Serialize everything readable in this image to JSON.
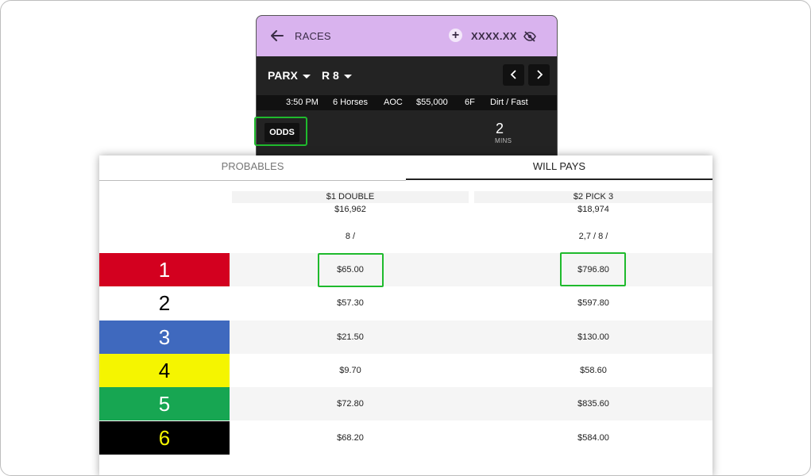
{
  "header": {
    "back_label": "RACES",
    "balance": "XXXX.XX"
  },
  "race_select": {
    "track": "PARX",
    "race": "R 8"
  },
  "race_info": {
    "post_time": "3:50 PM",
    "field_size": "6 Horses",
    "race_type": "AOC",
    "purse": "$55,000",
    "distance": "6F",
    "surface": "Dirt / Fast"
  },
  "odds_button": "ODDS",
  "mtp": {
    "value": "2",
    "label": "MINS"
  },
  "tabs": [
    {
      "label": "PROBABLES",
      "active": false
    },
    {
      "label": "WILL PAYS",
      "active": true
    }
  ],
  "columns": [
    {
      "bet": "$1 DOUBLE",
      "pool": "$16,962",
      "selection": "8 /"
    },
    {
      "bet": "$2 PICK 3",
      "pool": "$18,974",
      "selection": "2,7 / 8 /"
    }
  ],
  "rows": [
    {
      "number": "1",
      "bg": "#d3001f",
      "fg": "#ffffff",
      "double": "$65.00",
      "pick3": "$796.80"
    },
    {
      "number": "2",
      "bg": "#ffffff",
      "fg": "#000000",
      "double": "$57.30",
      "pick3": "$597.80"
    },
    {
      "number": "3",
      "bg": "#3f69be",
      "fg": "#ffffff",
      "double": "$21.50",
      "pick3": "$130.00"
    },
    {
      "number": "4",
      "bg": "#f5f500",
      "fg": "#000000",
      "double": "$9.70",
      "pick3": "$58.60"
    },
    {
      "number": "5",
      "bg": "#17a652",
      "fg": "#ffffff",
      "double": "$72.80",
      "pick3": "$835.60"
    },
    {
      "number": "6",
      "bg": "#000000",
      "fg": "#f5f500",
      "double": "$68.20",
      "pick3": "$584.00"
    }
  ],
  "colors": {
    "header_bg": "#d9b3ee",
    "dark_bg": "#232323",
    "highlight": "#1fba2d"
  },
  "icons": [
    "back-arrow-icon",
    "plus-icon",
    "eye-off-icon",
    "caret-down-icon",
    "chevron-left-icon",
    "chevron-right-icon"
  ]
}
